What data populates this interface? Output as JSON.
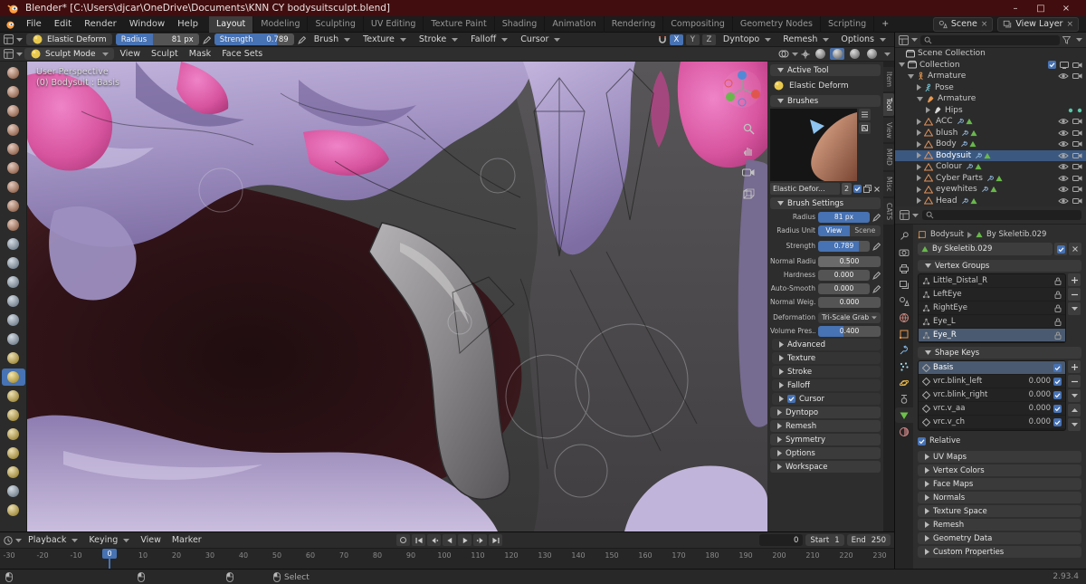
{
  "titlebar": {
    "title": "Blender* [C:\\Users\\djcar\\OneDrive\\Documents\\KNN CY bodysuitsculpt.blend]",
    "minimize": "–",
    "maximize": "□",
    "close": "×"
  },
  "topbar": {
    "menus": [
      "File",
      "Edit",
      "Render",
      "Window",
      "Help"
    ],
    "workspaces": [
      "Layout",
      "Modeling",
      "Sculpting",
      "UV Editing",
      "Texture Paint",
      "Shading",
      "Animation",
      "Rendering",
      "Compositing",
      "Geometry Nodes",
      "Scripting"
    ],
    "active_workspace": "Layout",
    "add_workspace": "+",
    "scene_label": "Scene",
    "view_layer_label": "View Layer"
  },
  "tool_header": {
    "tool_name": "Elastic Deform",
    "radius_label": "Radius",
    "radius_value": "81 px",
    "radius_fill": 0.45,
    "strength_label": "Strength",
    "strength_value": "0.789",
    "strength_fill": 0.79,
    "menus": [
      "Brush",
      "Texture",
      "Stroke",
      "Falloff",
      "Cursor"
    ],
    "mirror_axes": [
      "X",
      "Y",
      "Z"
    ],
    "mirror_active": "X",
    "popovers": [
      "Dyntopo",
      "Remesh",
      "Options"
    ]
  },
  "view_header": {
    "mode": "Sculpt Mode",
    "menus": [
      "View",
      "Sculpt",
      "Mask",
      "Face Sets"
    ]
  },
  "toolbar": {
    "tools": [
      {
        "name": "Draw",
        "color": "#c68c6f"
      },
      {
        "name": "Draw Sharp",
        "color": "#c68c6f"
      },
      {
        "name": "Clay",
        "color": "#c68c6f"
      },
      {
        "name": "Clay Strips",
        "color": "#c68c6f"
      },
      {
        "name": "Clay Thumb",
        "color": "#c68c6f"
      },
      {
        "name": "Layer",
        "color": "#c68c6f"
      },
      {
        "name": "Inflate",
        "color": "#c68c6f"
      },
      {
        "name": "Blob",
        "color": "#c68c6f"
      },
      {
        "name": "Crease",
        "color": "#c68c6f"
      },
      {
        "name": "Smooth",
        "color": "#9fb0c2"
      },
      {
        "name": "Flatten",
        "color": "#9fb0c2"
      },
      {
        "name": "Fill",
        "color": "#9fb0c2"
      },
      {
        "name": "Scrape",
        "color": "#9fb0c2"
      },
      {
        "name": "Multi-plane Scrape",
        "color": "#9fb0c2"
      },
      {
        "name": "Pinch",
        "color": "#9fb0c2"
      },
      {
        "name": "Grab",
        "color": "#d8bc57"
      },
      {
        "name": "Elastic Deform",
        "color": "#e8c94e",
        "selected": true
      },
      {
        "name": "Snake Hook",
        "color": "#d8bc57"
      },
      {
        "name": "Thumb",
        "color": "#d8bc57"
      },
      {
        "name": "Pose",
        "color": "#d8bc57"
      },
      {
        "name": "Nudge",
        "color": "#d8bc57"
      },
      {
        "name": "Rotate",
        "color": "#d8bc57"
      },
      {
        "name": "Slide Relax",
        "color": "#9fb0c2"
      },
      {
        "name": "Boundary",
        "color": "#d8bc57"
      }
    ]
  },
  "viewport": {
    "perspective_label": "User Perspective",
    "object_label": "(0) Bodysuit : Basis"
  },
  "sidebar_tabs": {
    "tabs": [
      "Item",
      "Tool",
      "View",
      "MMD",
      "Misc",
      "CATS"
    ],
    "active": "Tool"
  },
  "tool_panel": {
    "active_tool_header": "Active Tool",
    "tool_name": "Elastic Deform",
    "brushes_header": "Brushes",
    "brush_name": "Elastic Defor...",
    "brush_count": "2",
    "brush_settings_header": "Brush Settings",
    "settings": [
      {
        "label": "Radius",
        "value": "81 px",
        "type": "slider",
        "fill": 1,
        "accent": true,
        "icons": [
          "stylus"
        ]
      },
      {
        "label": "Radius Unit",
        "type": "toggle",
        "options": [
          "View",
          "Scene"
        ],
        "active": "View"
      },
      {
        "label": "Strength",
        "value": "0.789",
        "type": "slider",
        "fill": 0.79,
        "accent": true,
        "icons": [
          "stylus"
        ],
        "gap": true
      },
      {
        "label": "Normal Radiu",
        "value": "0.500",
        "type": "slider",
        "fill": 0.5,
        "accent": false,
        "gap": true
      },
      {
        "label": "Hardness",
        "value": "0.000",
        "type": "slider",
        "fill": 0,
        "accent": false,
        "icons": [
          "stylus"
        ]
      },
      {
        "label": "Auto-Smooth",
        "value": "0.000",
        "type": "slider",
        "fill": 0,
        "accent": false,
        "icons": [
          "stylus"
        ]
      },
      {
        "label": "Normal Weig...",
        "value": "0.000",
        "type": "slider",
        "fill": 0,
        "accent": false
      },
      {
        "label": "Deformation",
        "value": "Tri-Scale Grab",
        "type": "dropdown",
        "gap": true
      },
      {
        "label": "Volume Pres...",
        "value": "0.400",
        "type": "slider",
        "fill": 0.4,
        "accent": true
      }
    ],
    "sub_sections": [
      "Advanced",
      "Texture",
      "Stroke",
      "Falloff"
    ],
    "cursor_section": "Cursor",
    "sections": [
      "Dyntopo",
      "Remesh",
      "Symmetry",
      "Options",
      "Workspace"
    ]
  },
  "outliner": {
    "items": [
      {
        "label": "Scene Collection",
        "icon": "scene-collection",
        "level": 0,
        "arrow": "none",
        "right": []
      },
      {
        "label": "Collection",
        "icon": "collection",
        "level": 0,
        "arrow": "down",
        "right": [
          "checkbox",
          "screen",
          "camera"
        ]
      },
      {
        "label": "Armature",
        "icon": "armature",
        "level": 1,
        "arrow": "down",
        "right": [
          "eye",
          "camera"
        ]
      },
      {
        "label": "Pose",
        "icon": "pose",
        "level": 2,
        "arrow": "right",
        "right": []
      },
      {
        "label": "Armature",
        "icon": "armature-data",
        "level": 2,
        "arrow": "down",
        "right": []
      },
      {
        "label": "Hips",
        "icon": "bone",
        "level": 3,
        "arrow": "right",
        "right": [
          "dot",
          "dot"
        ]
      },
      {
        "label": "ACC",
        "icon": "mesh",
        "level": 2,
        "arrow": "right",
        "right": [
          "eye",
          "camera"
        ],
        "mods": true
      },
      {
        "label": "blush",
        "icon": "mesh",
        "level": 2,
        "arrow": "right",
        "right": [
          "eye",
          "camera"
        ],
        "mods": true
      },
      {
        "label": "Body",
        "icon": "mesh",
        "level": 2,
        "arrow": "right",
        "right": [
          "eye",
          "camera"
        ],
        "mods": true
      },
      {
        "label": "Bodysuit",
        "icon": "mesh",
        "level": 2,
        "arrow": "right",
        "right": [
          "eye",
          "camera"
        ],
        "mods": true,
        "selected": true
      },
      {
        "label": "Colour",
        "icon": "mesh",
        "level": 2,
        "arrow": "right",
        "right": [
          "eye",
          "camera"
        ],
        "mods": true
      },
      {
        "label": "Cyber Parts",
        "icon": "mesh",
        "level": 2,
        "arrow": "right",
        "right": [
          "eye",
          "camera"
        ],
        "mods": true
      },
      {
        "label": "eyewhites",
        "icon": "mesh",
        "level": 2,
        "arrow": "right",
        "right": [
          "eye",
          "camera"
        ],
        "mods": true
      },
      {
        "label": "Head",
        "icon": "mesh",
        "level": 2,
        "arrow": "right",
        "right": [
          "eye",
          "camera"
        ],
        "mods": true
      }
    ]
  },
  "properties": {
    "tabs": [
      "tool",
      "render",
      "output",
      "view-layer",
      "scene",
      "world",
      "object",
      "modifiers",
      "particles",
      "physics",
      "constraints",
      "object-data",
      "material"
    ],
    "active_tab": "object-data",
    "breadcrumb_object": "Bodysuit",
    "breadcrumb_data": "By Skeletib.029",
    "data_field": "By Skeletib.029",
    "vertex_groups_header": "Vertex Groups",
    "vertex_groups": [
      "Little_Distal_R",
      "LeftEye",
      "RightEye",
      "Eye_L",
      "Eye_R"
    ],
    "vertex_groups_selected": "Eye_R",
    "shape_keys_header": "Shape Keys",
    "shape_keys": [
      {
        "name": "Basis",
        "value": "",
        "selected": true
      },
      {
        "name": "vrc.blink_left",
        "value": "0.000"
      },
      {
        "name": "vrc.blink_right",
        "value": "0.000"
      },
      {
        "name": "vrc.v_aa",
        "value": "0.000"
      },
      {
        "name": "vrc.v_ch",
        "value": "0.000"
      }
    ],
    "relative_label": "Relative",
    "sections": [
      "UV Maps",
      "Vertex Colors",
      "Face Maps",
      "Normals",
      "Texture Space",
      "Remesh",
      "Geometry Data",
      "Custom Properties"
    ]
  },
  "timeline": {
    "menus": [
      "Playback",
      "Keying",
      "View",
      "Marker"
    ],
    "transport": [
      "auto-key",
      "jump-start",
      "prev-keyframe",
      "play-reverse",
      "play",
      "next-keyframe",
      "jump-end"
    ],
    "frame_value": "0",
    "start_label": "Start",
    "start_value": "1",
    "end_label": "End",
    "end_value": "250",
    "ticks": [
      -30,
      -20,
      -10,
      0,
      10,
      20,
      30,
      40,
      50,
      60,
      70,
      80,
      90,
      100,
      110,
      120,
      130,
      140,
      150,
      160,
      170,
      180,
      190,
      200,
      210,
      220,
      230
    ],
    "current_frame": 0
  },
  "statusbar": {
    "hint": "Select",
    "version": "2.93.4"
  },
  "colors": {
    "accent": "#4772b3",
    "titlebar": "#410d0e",
    "selected_row": "#3b5880"
  }
}
